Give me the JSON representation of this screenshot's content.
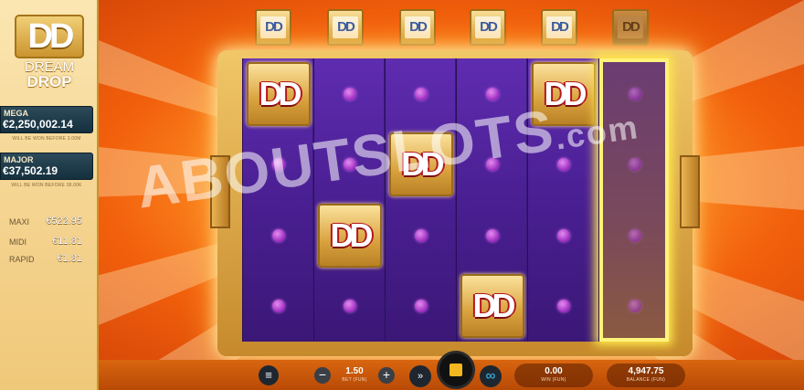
{
  "game": {
    "logo": {
      "mark": "DD",
      "line1": "DREAM",
      "line2": "DROP"
    }
  },
  "jackpots": {
    "mega": {
      "name": "MEGA",
      "value": "€2,250,002.14",
      "note": "WILL BE WON BEFORE 3.00M"
    },
    "major": {
      "name": "MAJOR",
      "value": "€37,502.19",
      "note": "WILL BE WON BEFORE 38.00K"
    },
    "small": [
      {
        "name": "MAXI",
        "value": "€522.95"
      },
      {
        "name": "MIDI",
        "value": "€11.81"
      },
      {
        "name": "RAPID",
        "value": "€1.81"
      }
    ]
  },
  "top_markers": [
    {
      "label": "DD",
      "state": "active"
    },
    {
      "label": "DD",
      "state": "active"
    },
    {
      "label": "DD",
      "state": "active"
    },
    {
      "label": "DD",
      "state": "active"
    },
    {
      "label": "DD",
      "state": "active"
    },
    {
      "label": "DD",
      "state": "inactive"
    }
  ],
  "reels": [
    [
      "DD",
      "dot",
      "dot",
      "dot"
    ],
    [
      "dot",
      "dot",
      "DD",
      "dot"
    ],
    [
      "dot",
      "DD",
      "dot",
      "dot"
    ],
    [
      "dot",
      "dot",
      "dot",
      "DD"
    ],
    [
      "DD",
      "dot",
      "dot",
      "dot"
    ],
    [
      "dot",
      "dot",
      "dot",
      "dot"
    ]
  ],
  "highlighted_reel": 6,
  "watermark": {
    "main": "ABOUTSLOTS",
    "suffix": ".com"
  },
  "bottom_bar": {
    "menu_icon": "≡",
    "bet_minus": "−",
    "bet_plus": "+",
    "bet": {
      "value": "1.50",
      "label": "BET (FUN)"
    },
    "fast_icon": "»",
    "auto_icon": "∞",
    "win": {
      "value": "0.00",
      "label": "WIN (FUN)"
    },
    "balance": {
      "value": "4,947.75",
      "label": "BALANCE (FUN)"
    }
  },
  "colors": {
    "reel": "#4a1f92",
    "frame_gold": "#d09a34",
    "dd_red": "#b4151d",
    "jackpot_box": "#1f3b4a",
    "spin_stop": "#f3b81f",
    "auto_cyan": "#39c8ff"
  }
}
